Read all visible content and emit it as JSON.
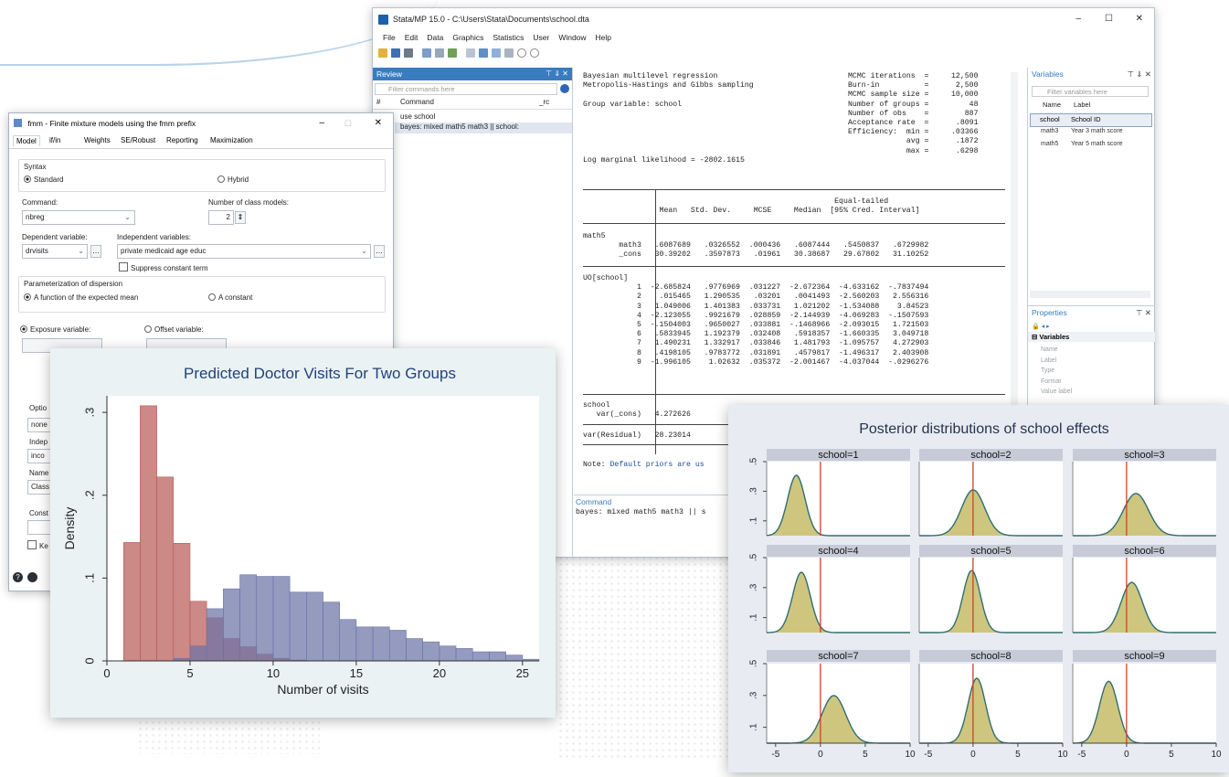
{
  "stata": {
    "title": "Stata/MP 15.0 - C:\\Users\\Stata\\Documents\\school.dta",
    "controls": {
      "minimize": "–",
      "maximize": "☐",
      "close": "✕"
    },
    "menu": [
      "File",
      "Edit",
      "Data",
      "Graphics",
      "Statistics",
      "User",
      "Window",
      "Help"
    ],
    "review": {
      "title": "Review",
      "filter_placeholder": "Filter commands here",
      "col_num": "#",
      "col_command": "Command",
      "col_rc": "_rc",
      "items": [
        "use school",
        "bayes: mixed math5 math3 || school:"
      ]
    },
    "results": {
      "header_left": "Bayesian multilevel regression\nMetropolis-Hastings and Gibbs sampling\n\nGroup variable: school\n\n\n\n\n\nLog marginal likelihood = -2802.1615",
      "header_right": "MCMC iterations  =     12,500\nBurn-in          =      2,500\nMCMC sample size =     10,000\nNumber of groups =         48\nNumber of obs    =        887\nAcceptance rate  =      .8091\nEfficiency:  min =     .03366\n             avg =      .1872\n             max =      .6298",
      "table_head": "                                                        Equal-tailed\n                 Mean   Std. Dev.     MCSE     Median  [95% Cred. Interval]",
      "block_math5": "math5\n        math3   .6087689   .0326552  .000436   .6087444   .5450837   .6729982\n        _cons   30.39202   .3597873   .01961   30.38687   29.67802   31.10252",
      "block_uo": "UO[school]\n            1  -2.685824   .9776969  .031227  -2.672364  -4.633162  -.7837494\n            2    .015465   1.290535   .03201   .0041493  -2.560203   2.556316\n            3   1.049006   1.401383  .033731   1.021202  -1.534088    3.84523\n            4  -2.123055   .9921679  .028859  -2.144939  -4.069283  -.1507593\n            5  -.1504003   .9650027  .033881  -.1468966  -2.093015   1.721503\n            6   .5833945   1.192379  .032408   .5918357  -1.660335   3.049718\n            7   1.490231   1.332917  .033846   1.481793  -1.095757   4.272903\n            8   .4198105   .9783772  .031891   .4579817  -1.496317   2.403908\n            9  -1.996105    1.02632  .035372  -2.001467  -4.037044  -.0296276",
      "block_school": "school\n   var(_cons)   4.272626",
      "block_resid": "var(Residual)   28.23014",
      "note_label": "Note:",
      "note_text": " Default priors are us"
    },
    "command": {
      "title": "Command",
      "text": "bayes: mixed math5 math3 || s"
    },
    "variables": {
      "title": "Variables",
      "filter_placeholder": "Filter variables here",
      "col_name": "Name",
      "col_label": "Label",
      "rows": [
        {
          "name": "school",
          "label": "School ID"
        },
        {
          "name": "math3",
          "label": "Year 3 math score"
        },
        {
          "name": "math5",
          "label": "Year 5 math score"
        }
      ]
    },
    "properties": {
      "title": "Properties",
      "section": "Variables",
      "fields": [
        "Name",
        "Label",
        "Type",
        "Format",
        "Value label"
      ]
    }
  },
  "dialog": {
    "title": "fmm - Finite mixture models using the fmm prefix",
    "tabs": [
      "Model",
      "if/in",
      "Weights",
      "SE/Robust",
      "Reporting",
      "Maximization"
    ],
    "syntax_label": "Syntax",
    "syntax_standard": "Standard",
    "syntax_hybrid": "Hybrid",
    "command_label": "Command:",
    "command_value": "nbreg",
    "num_class_label": "Number of class models:",
    "num_class_value": "2",
    "depvar_label": "Dependent variable:",
    "depvar_value": "drvisits",
    "indepvar_label": "Independent variables:",
    "indepvar_value": "private medicaid age educ",
    "suppress_label": "Suppress constant term",
    "param_label": "Parameterization of dispersion",
    "param_expected": "A function of the expected mean",
    "param_constant": "A constant",
    "exposure_label": "Exposure variable:",
    "offset_label": "Offset variable:",
    "options_label": "Optio",
    "options_value": "none",
    "indep2_label": "Indep",
    "indep2_value": "inco",
    "name_label": "Name",
    "name_value": "Class",
    "const_label": "Const",
    "keep_label": "Ke"
  },
  "charts": {
    "histogram": {
      "title": "Predicted Doctor Visits For Two Groups",
      "colors": {
        "red": "#b85c57",
        "blue": "#6c73a6",
        "bg": "#eaf2f3"
      }
    },
    "posterior": {
      "title": "Posterior distributions of school effects",
      "colors": {
        "fill": "#c9c071",
        "line": "#2f6f70",
        "redline": "#d0402a",
        "strip": "#c7cbd8",
        "bg": "#e9ebf2"
      }
    }
  },
  "chart_data": [
    {
      "type": "bar",
      "title": "Predicted Doctor Visits For Two Groups",
      "xlabel": "Number of visits",
      "ylabel": "Density",
      "xlim": [
        0,
        26
      ],
      "ylim": [
        0,
        0.32
      ],
      "x_ticks": [
        "0",
        "5",
        "10",
        "15",
        "20",
        "25"
      ],
      "y_ticks": [
        "0",
        ".1",
        ".2",
        ".3"
      ],
      "bin_width": 1,
      "series": [
        {
          "color": "red",
          "bins": [
            [
              1,
              0.143
            ],
            [
              2,
              0.308
            ],
            [
              3,
              0.222
            ],
            [
              4,
              0.142
            ],
            [
              5,
              0.072
            ],
            [
              6,
              0.052
            ],
            [
              7,
              0.027
            ],
            [
              8,
              0.017
            ],
            [
              9,
              0.008
            ],
            [
              10,
              0.003
            ],
            [
              11,
              0.001
            ]
          ]
        },
        {
          "color": "blue",
          "bins": [
            [
              4,
              0.003
            ],
            [
              5,
              0.018
            ],
            [
              6,
              0.063
            ],
            [
              7,
              0.087
            ],
            [
              8,
              0.104
            ],
            [
              9,
              0.102
            ],
            [
              10,
              0.102
            ],
            [
              11,
              0.083
            ],
            [
              12,
              0.083
            ],
            [
              13,
              0.071
            ],
            [
              14,
              0.05
            ],
            [
              15,
              0.041
            ],
            [
              16,
              0.041
            ],
            [
              17,
              0.037
            ],
            [
              18,
              0.027
            ],
            [
              19,
              0.023
            ],
            [
              20,
              0.018
            ],
            [
              21,
              0.015
            ],
            [
              22,
              0.011
            ],
            [
              23,
              0.011
            ],
            [
              24,
              0.007
            ],
            [
              25,
              0.002
            ]
          ]
        }
      ]
    },
    {
      "type": "area",
      "title": "Posterior distributions of school effects",
      "xlim": [
        -6,
        10
      ],
      "ylim": [
        0,
        0.5
      ],
      "x_ticks": [
        "-5",
        "0",
        "5",
        "10"
      ],
      "y_ticks": [
        ".1",
        ".3",
        ".5"
      ],
      "panels": [
        {
          "label": "school=1",
          "mean": -2.686,
          "sd": 0.978
        },
        {
          "label": "school=2",
          "mean": 0.015,
          "sd": 1.291
        },
        {
          "label": "school=3",
          "mean": 1.049,
          "sd": 1.401
        },
        {
          "label": "school=4",
          "mean": -2.123,
          "sd": 0.992
        },
        {
          "label": "school=5",
          "mean": -0.15,
          "sd": 0.965
        },
        {
          "label": "school=6",
          "mean": 0.583,
          "sd": 1.192
        },
        {
          "label": "school=7",
          "mean": 1.49,
          "sd": 1.333
        },
        {
          "label": "school=8",
          "mean": 0.42,
          "sd": 0.978
        },
        {
          "label": "school=9",
          "mean": -1.996,
          "sd": 1.026
        }
      ],
      "reference_line_x": 0
    }
  ]
}
